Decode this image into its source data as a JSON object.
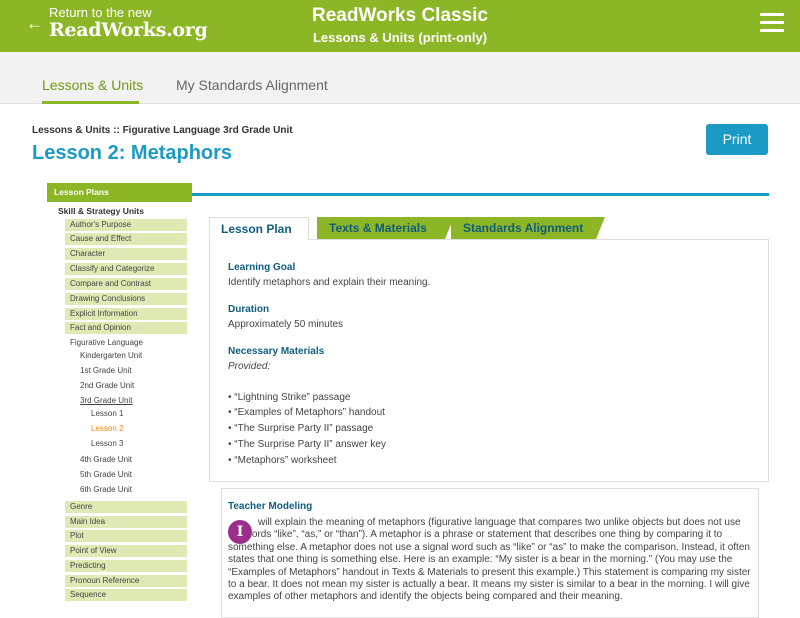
{
  "header": {
    "back_line1": "Return to the new",
    "back_line2": "ReadWorks.org",
    "back_arrow": "←",
    "brand_title": "ReadWorks Classic",
    "brand_subtitle": "Lessons & Units (print-only)",
    "menu_icon": "hamburger-menu-icon",
    "color": "#8cb625"
  },
  "nav": {
    "tabs": [
      {
        "label": "Lessons & Units",
        "active": true
      },
      {
        "label": "My Standards Alignment",
        "active": false
      }
    ]
  },
  "breadcrumb": "Lessons & Units :: Figurative Language 3rd Grade Unit",
  "page_title": "Lesson 2: Metaphors",
  "print_label": "Print",
  "accent_blue": "#1c9ac6",
  "sidebar": {
    "header": "Lesson Plans",
    "section": "Skill & Strategy Units",
    "items_top": [
      "Author's Purpose",
      "Cause and Effect",
      "Character",
      "Classify and Categorize",
      "Compare and Contrast",
      "Drawing Conclusions",
      "Explicit Information",
      "Fact and Opinion"
    ],
    "fig_lang": "Figurative Language",
    "grades_top": [
      "Kindergarten Unit",
      "1st Grade Unit",
      "2nd Grade Unit",
      "3rd Grade Unit"
    ],
    "lessons": [
      "Lesson 1",
      "Lesson 2",
      "Lesson 3"
    ],
    "grades_bottom": [
      "4th Grade Unit",
      "5th Grade Unit",
      "6th Grade Unit"
    ],
    "items_bottom": [
      "Genre",
      "Main Idea",
      "Plot",
      "Point of View",
      "Predicting",
      "Pronoun Reference",
      "Sequence"
    ]
  },
  "content_tabs": [
    "Lesson Plan",
    "Texts & Materials",
    "Standards Alignment"
  ],
  "lesson": {
    "goal_head": "Learning Goal",
    "goal_text": "Identify metaphors and explain their meaning.",
    "duration_head": "Duration",
    "duration_text": "Approximately 50 minutes",
    "materials_head": "Necessary Materials",
    "materials_provided": "Provided:",
    "materials": [
      "• “Lightning Strike” passage",
      "• “Examples of Metaphors” handout",
      "• “The Surprise Party II” passage",
      "• “The Surprise Party II” answer key",
      "• “Metaphors” worksheet"
    ],
    "tm_head": "Teacher Modeling",
    "tm_badge": "I",
    "tm_text": "will explain the meaning of metaphors (figurative language that compares two unlike objects but does not use the words “like”, “as,” or “than”). A metaphor is a phrase or statement that describes one thing by comparing it to something else. A metaphor does not use a signal word such as “like” or “as” to make the comparison. Instead, it often states that one thing is something else. Here is an example: “My sister is a bear in the morning.” (You may use the “Examples of Metaphors” handout in Texts & Materials to present this example.) This statement is comparing my sister to a bear. It does not mean my sister is actually a bear. It means my sister is similar to a bear in the morning. I will give examples of other metaphors and identify the objects being compared and their meaning."
  }
}
